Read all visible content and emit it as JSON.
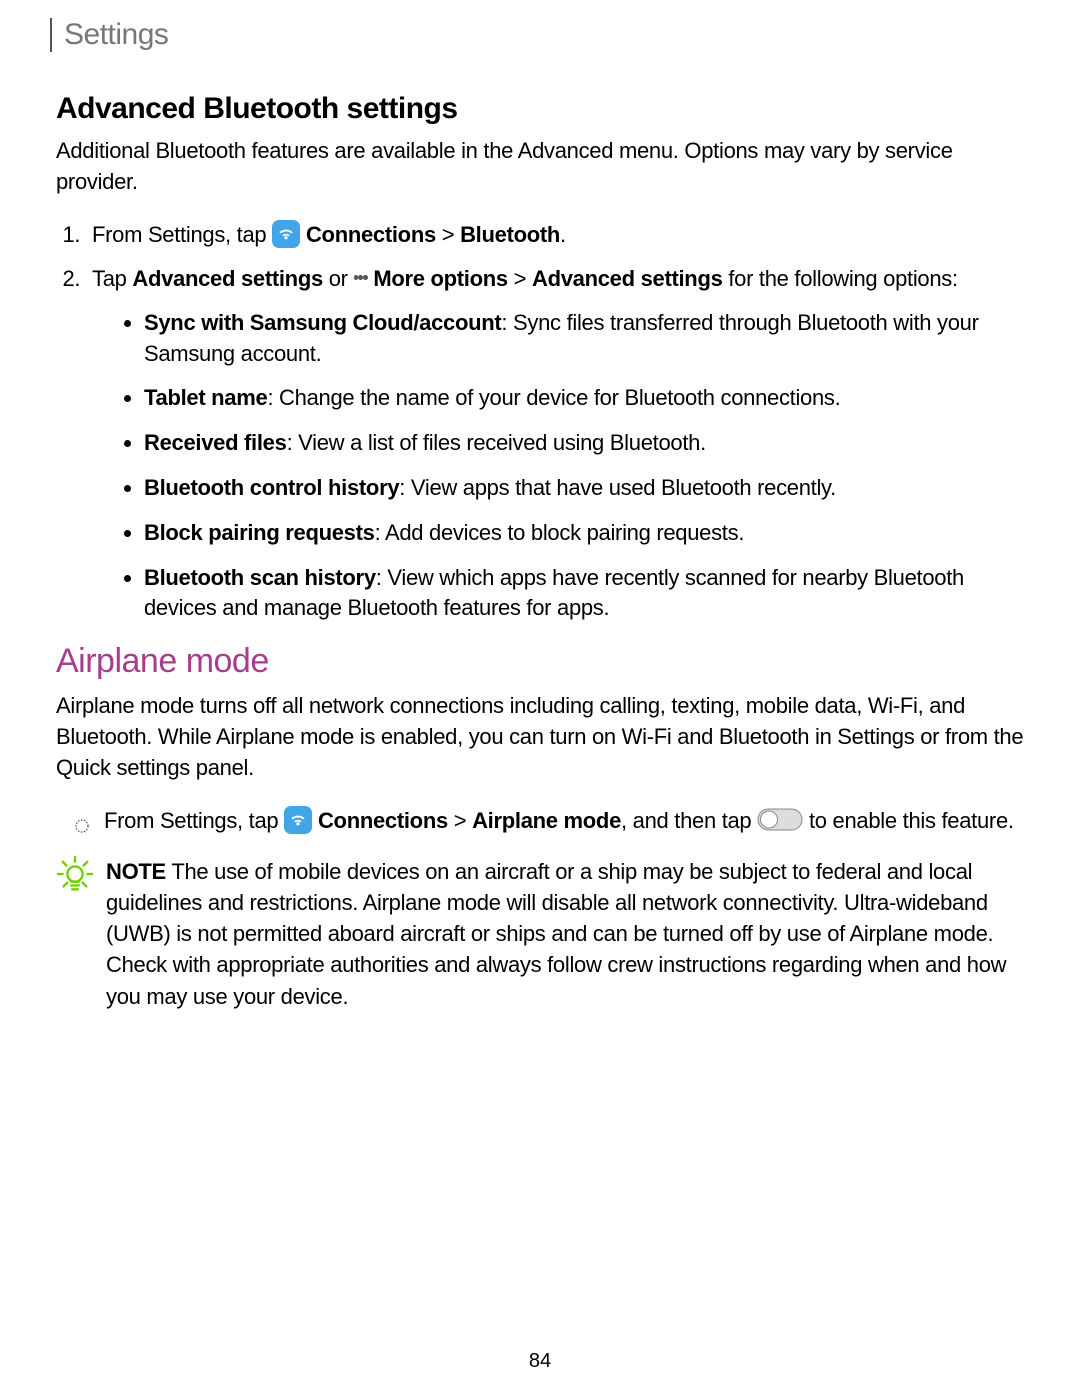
{
  "header": {
    "title": "Settings"
  },
  "section1": {
    "heading": "Advanced Bluetooth settings",
    "intro": "Additional Bluetooth features are available in the Advanced menu. Options may vary by service provider.",
    "step1_pre": "From Settings, tap ",
    "step1_b1": "Connections",
    "step1_gt": " > ",
    "step1_b2": "Bluetooth",
    "step1_post": ".",
    "step2_pre": "Tap ",
    "step2_b1": "Advanced settings",
    "step2_mid1": " or ",
    "step2_b2": "More options",
    "step2_gt": " > ",
    "step2_b3": "Advanced settings",
    "step2_post": " for the following options:",
    "bullets": [
      {
        "label": "Sync with Samsung Cloud/account",
        "desc": ": Sync files transferred through Bluetooth with your Samsung account."
      },
      {
        "label": "Tablet name",
        "desc": ": Change the name of your device for Bluetooth connections."
      },
      {
        "label": "Received files",
        "desc": ": View a list of files received using Bluetooth."
      },
      {
        "label": "Bluetooth control history",
        "desc": ": View apps that have used Bluetooth recently."
      },
      {
        "label": "Block pairing requests",
        "desc": ": Add devices to block pairing requests."
      },
      {
        "label": "Bluetooth scan history",
        "desc": ": View which apps have recently scanned for nearby Bluetooth devices and manage Bluetooth features for apps."
      }
    ]
  },
  "section2": {
    "heading": "Airplane mode",
    "intro": "Airplane mode turns off all network connections including calling, texting, mobile data, Wi-Fi, and Bluetooth. While Airplane mode is enabled, you can turn on Wi-Fi and Bluetooth in Settings or from the Quick settings panel.",
    "step_pre": "From Settings, tap ",
    "step_b1": "Connections",
    "step_gt": " > ",
    "step_b2": "Airplane mode",
    "step_mid": ", and then tap ",
    "step_post": " to enable this feature.",
    "note_label": "NOTE",
    "note_text": "  The use of mobile devices on an aircraft or a ship may be subject to federal and local guidelines and restrictions. Airplane mode will disable all network connectivity. Ultra-wideband (UWB) is not permitted aboard aircraft or ships and can be turned off by use of Airplane mode. Check with appropriate authorities and always follow crew instructions regarding when and how you may use your device."
  },
  "page_number": "84"
}
